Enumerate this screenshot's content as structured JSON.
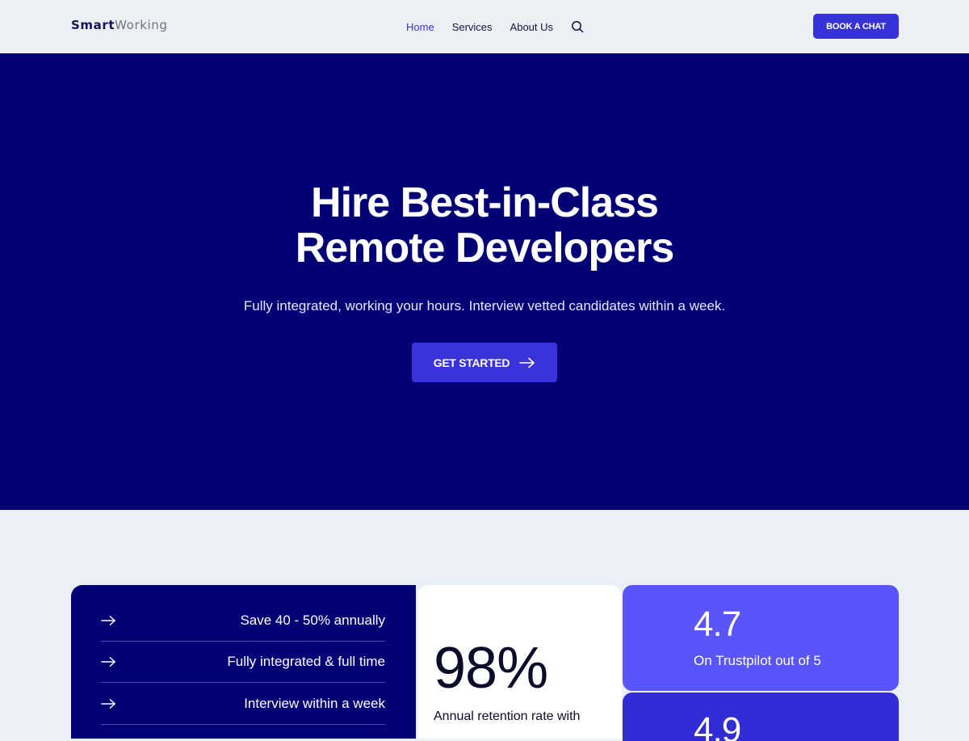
{
  "header": {
    "logo_smart": "Smart",
    "logo_working": "Working",
    "nav": [
      {
        "label": "Home",
        "active": true
      },
      {
        "label": "Services",
        "active": false
      },
      {
        "label": "About Us",
        "active": false
      }
    ],
    "search_icon": "search-icon",
    "cta_label": "BOOK A CHAT"
  },
  "hero": {
    "title_line1": "Hire Best-in-Class",
    "title_line2": "Remote Developers",
    "subtitle": "Fully integrated, working your hours. Interview vetted candidates within a week.",
    "cta_label": "GET STARTED",
    "cta_icon": "arrow-right-icon"
  },
  "features": {
    "items": [
      {
        "label": "Save 40 - 50% annually",
        "icon": "arrow-right-icon"
      },
      {
        "label": "Fully integrated & full time",
        "icon": "arrow-right-icon"
      },
      {
        "label": "Interview within a week",
        "icon": "arrow-right-icon"
      }
    ]
  },
  "stats": {
    "retention_value": "98%",
    "retention_label": "Annual retention rate with",
    "rating_value": "4.7",
    "rating_label": "On Trustpilot out of 5",
    "rating2_value": "4.9"
  },
  "colors": {
    "brand_navy": "#020075",
    "accent": "#3631d8",
    "card_violet": "#5955fb",
    "page_bg": "#eaf0f5"
  }
}
